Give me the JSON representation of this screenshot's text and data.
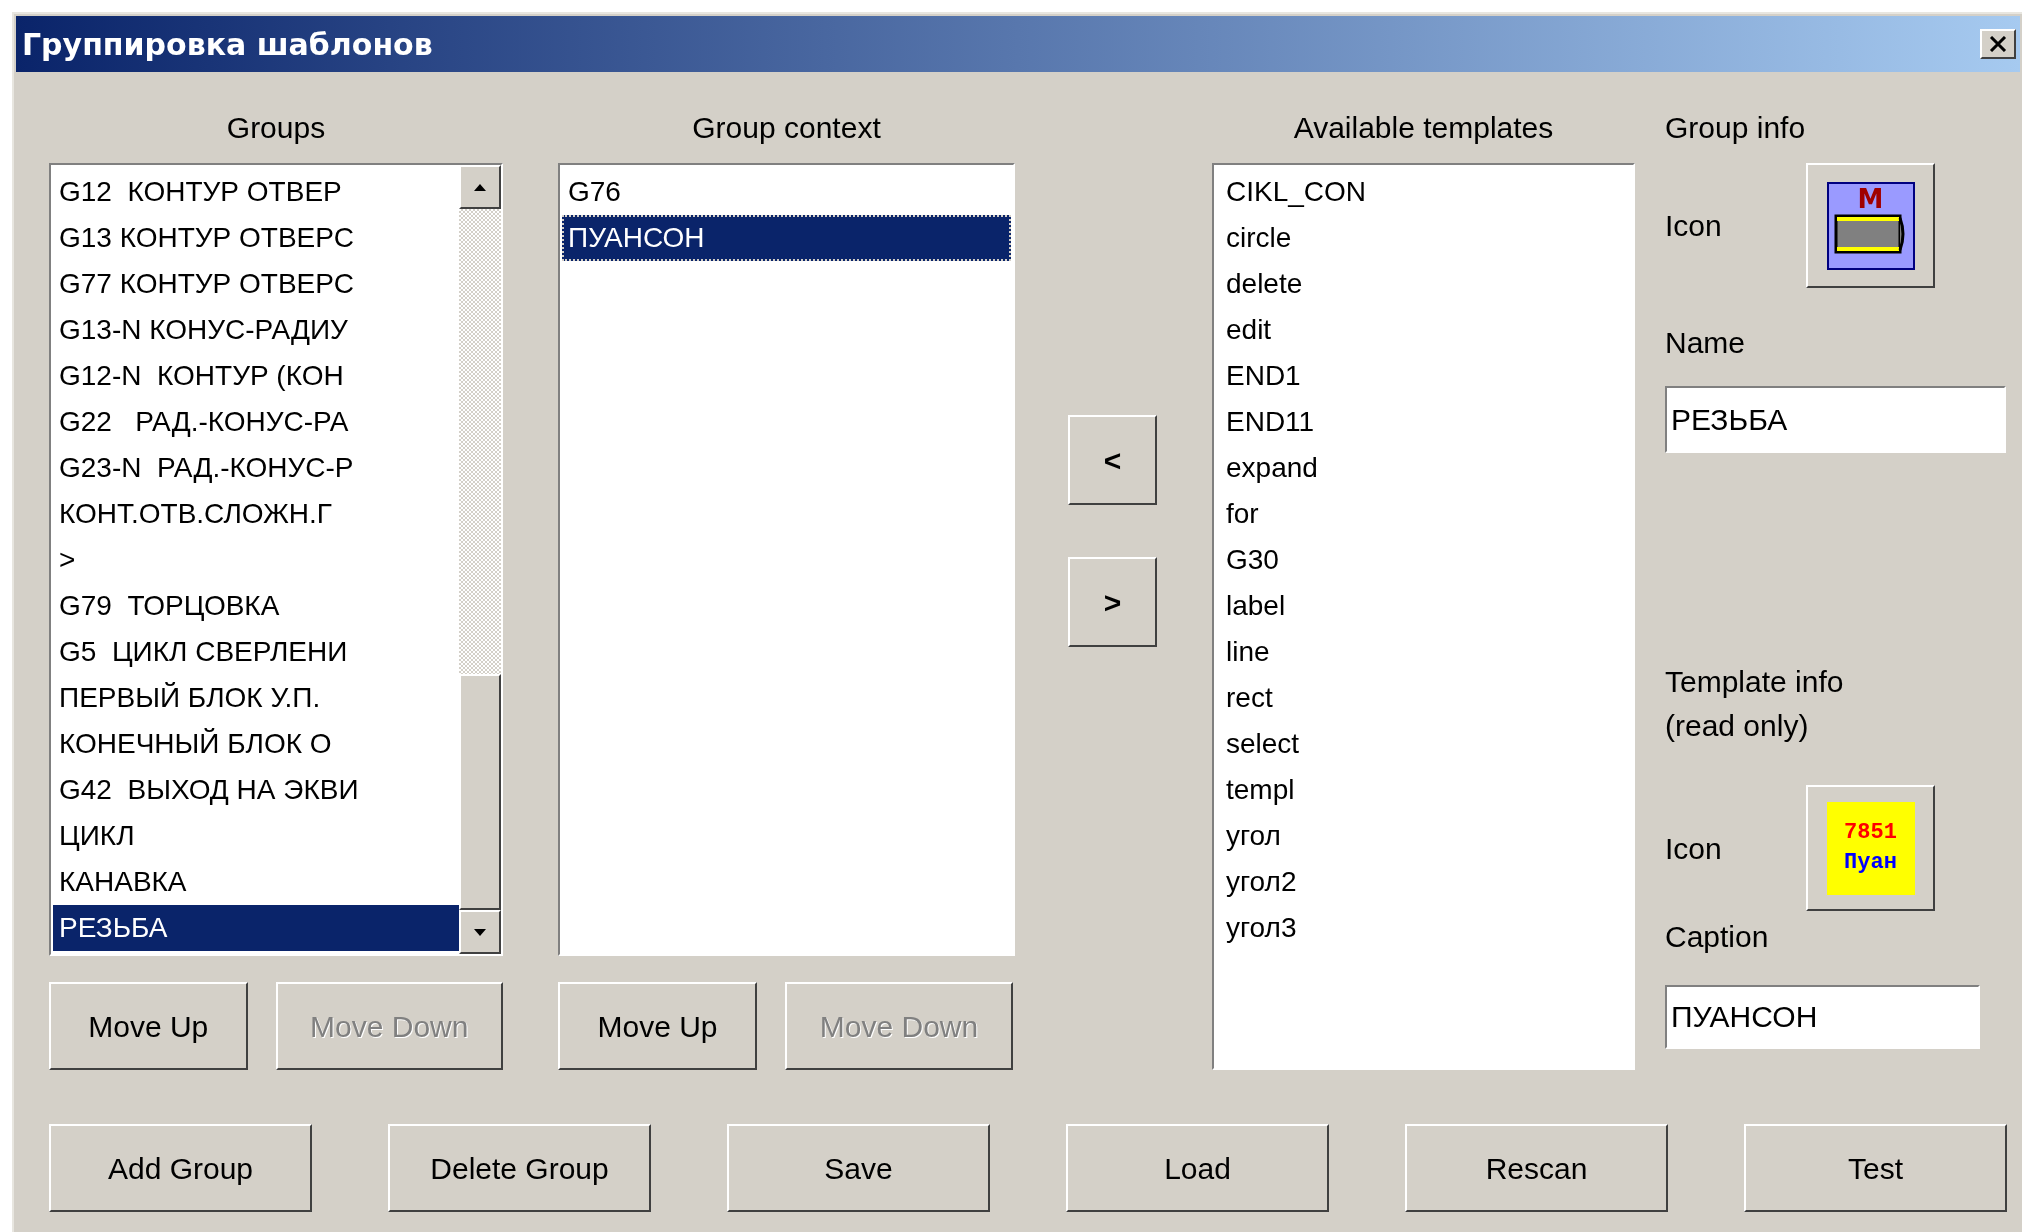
{
  "window": {
    "title": "Группировка шаблонов"
  },
  "groups": {
    "heading": "Groups",
    "items": [
      {
        "label": "G12  КОНТУР ОТВЕР",
        "selected": false
      },
      {
        "label": "G13 КОНТУР ОТВЕРС",
        "selected": false
      },
      {
        "label": "G77 КОНТУР ОТВЕРС",
        "selected": false
      },
      {
        "label": "G13-N КОНУС-РАДИУ",
        "selected": false
      },
      {
        "label": "G12-N  КОНТУР (КОН",
        "selected": false
      },
      {
        "label": "G22   РАД.-КОНУС-РА",
        "selected": false
      },
      {
        "label": "G23-N  РАД.-КОНУС-Р",
        "selected": false
      },
      {
        "label": "КОНТ.ОТВ.СЛОЖН.Г",
        "selected": false
      },
      {
        "label": ">",
        "selected": false
      },
      {
        "label": "G79  ТОРЦОВКА",
        "selected": false
      },
      {
        "label": "G5  ЦИКЛ СВЕРЛЕНИ",
        "selected": false
      },
      {
        "label": "ПЕРВЫЙ БЛОК У.П.",
        "selected": false
      },
      {
        "label": "КОНЕЧНЫЙ БЛОК О",
        "selected": false
      },
      {
        "label": "G42  ВЫХОД НА ЭКВИ",
        "selected": false
      },
      {
        "label": "ЦИКЛ",
        "selected": false
      },
      {
        "label": "КАНАВКА",
        "selected": false
      },
      {
        "label": "РЕЗЬБА",
        "selected": true
      }
    ],
    "buttons": [
      {
        "label": "Move Up",
        "disabled": false
      },
      {
        "label": "Move Down",
        "disabled": true
      }
    ]
  },
  "group_context": {
    "heading": "Group context",
    "items": [
      {
        "label": "G76",
        "selected": false
      },
      {
        "label": "ПУАНСОН",
        "selected": true
      }
    ],
    "buttons": [
      {
        "label": "Move Up",
        "disabled": false
      },
      {
        "label": "Move Down",
        "disabled": true
      }
    ]
  },
  "transfer_buttons": [
    "<",
    ">"
  ],
  "available_templates": {
    "heading": "Available templates",
    "items": [
      {
        "label": "CIKL_CON",
        "selected": false
      },
      {
        "label": "circle",
        "selected": false
      },
      {
        "label": "delete",
        "selected": false
      },
      {
        "label": "edit",
        "selected": false
      },
      {
        "label": "END1",
        "selected": false
      },
      {
        "label": "END11",
        "selected": false
      },
      {
        "label": "expand",
        "selected": false
      },
      {
        "label": "for",
        "selected": false
      },
      {
        "label": "G30",
        "selected": false
      },
      {
        "label": "label",
        "selected": false
      },
      {
        "label": "line",
        "selected": false
      },
      {
        "label": "rect",
        "selected": false
      },
      {
        "label": "select",
        "selected": false
      },
      {
        "label": "templ",
        "selected": false
      },
      {
        "label": "угол",
        "selected": false
      },
      {
        "label": "угол2",
        "selected": false
      },
      {
        "label": "угол3",
        "selected": false
      }
    ]
  },
  "group_info": {
    "heading": "Group info",
    "icon_label": "Icon",
    "icon_text": "M",
    "name_label": "Name",
    "name_value": "РЕЗЬБА"
  },
  "template_info": {
    "heading": "Template info (read only)",
    "icon_label": "Icon",
    "icon_lines": [
      "7851",
      "Пуан"
    ],
    "caption_label": "Caption",
    "caption_value": "ПУАНСОН"
  },
  "bottom_buttons": [
    "Add Group",
    "Delete Group",
    "Save",
    "Load",
    "Rescan",
    "Test"
  ]
}
